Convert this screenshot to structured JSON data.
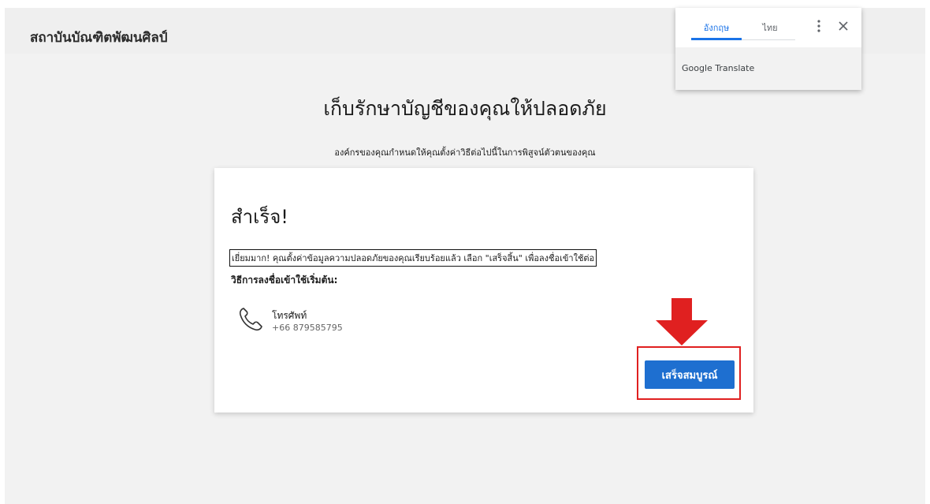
{
  "header": {
    "org_name": "สถาบันบัณฑิตพัฒนศิลป์"
  },
  "page": {
    "heading": "เก็บรักษาบัญชีของคุณให้ปลอดภัย",
    "subheading": "องค์กรของคุณกำหนดให้คุณตั้งค่าวิธีต่อไปนี้ในการพิสูจน์ตัวตนของคุณ"
  },
  "card": {
    "title": "สำเร็จ!",
    "message": "เยี่ยมมาก! คุณตั้งค่าข้อมูลความปลอดภัยของคุณเรียบร้อยแล้ว เลือก \"เสร็จสิ้น\" เพื่อลงชื่อเข้าใช้ต่อ",
    "method_header": "วิธีการลงชื่อเข้าใช้เริ่มต้น:",
    "method": {
      "icon": "phone-icon",
      "label": "โทรศัพท์",
      "value": "+66 879585795"
    },
    "finish_button": "เสร็จสมบูรณ์"
  },
  "translate_popup": {
    "tabs": [
      {
        "label": "อังกฤษ",
        "active": true
      },
      {
        "label": "ไทย",
        "active": false
      }
    ],
    "footer": "Google Translate"
  },
  "annotation": {
    "arrow_color": "#e02020",
    "highlight_color": "#e02020"
  },
  "colors": {
    "accent": "#1e6fd0",
    "translate_accent": "#1a73e8"
  }
}
